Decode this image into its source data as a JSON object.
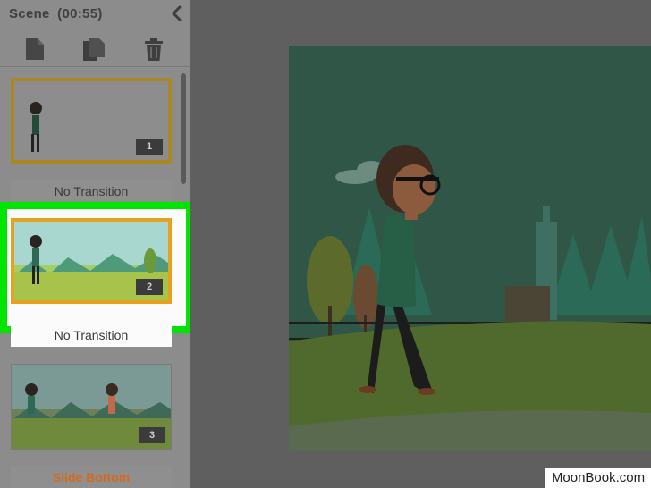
{
  "panel": {
    "title": "Scene",
    "duration": "(00:55)",
    "toolbar": {
      "new_icon": "new-scene-icon",
      "duplicate_icon": "duplicate-scene-icon",
      "delete_icon": "trash-icon"
    }
  },
  "scenes": [
    {
      "number": "1",
      "transition": "No Transition"
    },
    {
      "number": "2",
      "transition": "No Transition"
    },
    {
      "number": "3",
      "transition": "Slide Bottom"
    }
  ],
  "colors": {
    "highlight": "#00e400",
    "selected_border": "#e6a21e",
    "transition_accent": "#d66a1c"
  },
  "watermark": {
    "text": "MoonBook.com"
  }
}
